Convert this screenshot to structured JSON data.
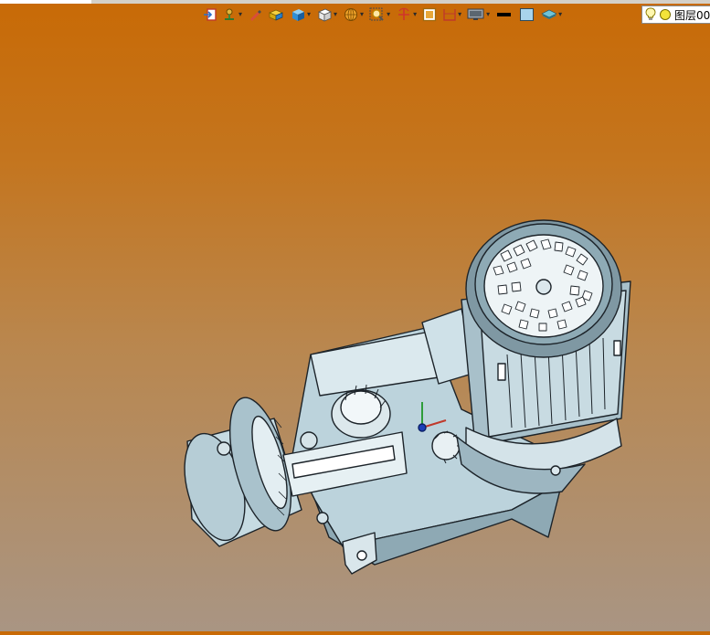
{
  "toolbar": {
    "buttons": [
      {
        "icon": "exit-icon",
        "dropdown": false
      },
      {
        "icon": "pin-tool-icon",
        "dropdown": true
      },
      {
        "icon": "pencil-icon",
        "dropdown": false
      },
      {
        "icon": "solid-block-icon",
        "dropdown": false
      },
      {
        "icon": "shaded-cube-icon",
        "dropdown": true
      },
      {
        "icon": "wireframe-cube-icon",
        "dropdown": true
      },
      {
        "icon": "sphere-view-icon",
        "dropdown": true
      },
      {
        "icon": "zoom-fit-icon",
        "dropdown": true
      },
      {
        "icon": "rotate-axis-icon",
        "dropdown": true
      },
      {
        "icon": "frame-icon",
        "dropdown": false
      },
      {
        "icon": "section-icon",
        "dropdown": true
      },
      {
        "icon": "display-monitor-icon",
        "dropdown": true
      },
      {
        "icon": "line-color-icon",
        "dropdown": false
      },
      {
        "icon": "background-color-icon",
        "dropdown": false
      },
      {
        "icon": "layer-stack-icon",
        "dropdown": true
      }
    ]
  },
  "layer": {
    "label": "图层00"
  },
  "colors": {
    "accent_orange": "#c86a06",
    "part_fill": "#c9dde3",
    "part_dark": "#7f98a3",
    "outline": "#1c2329"
  },
  "viewport": {
    "model_icon": "gearmotor-model-icon"
  }
}
